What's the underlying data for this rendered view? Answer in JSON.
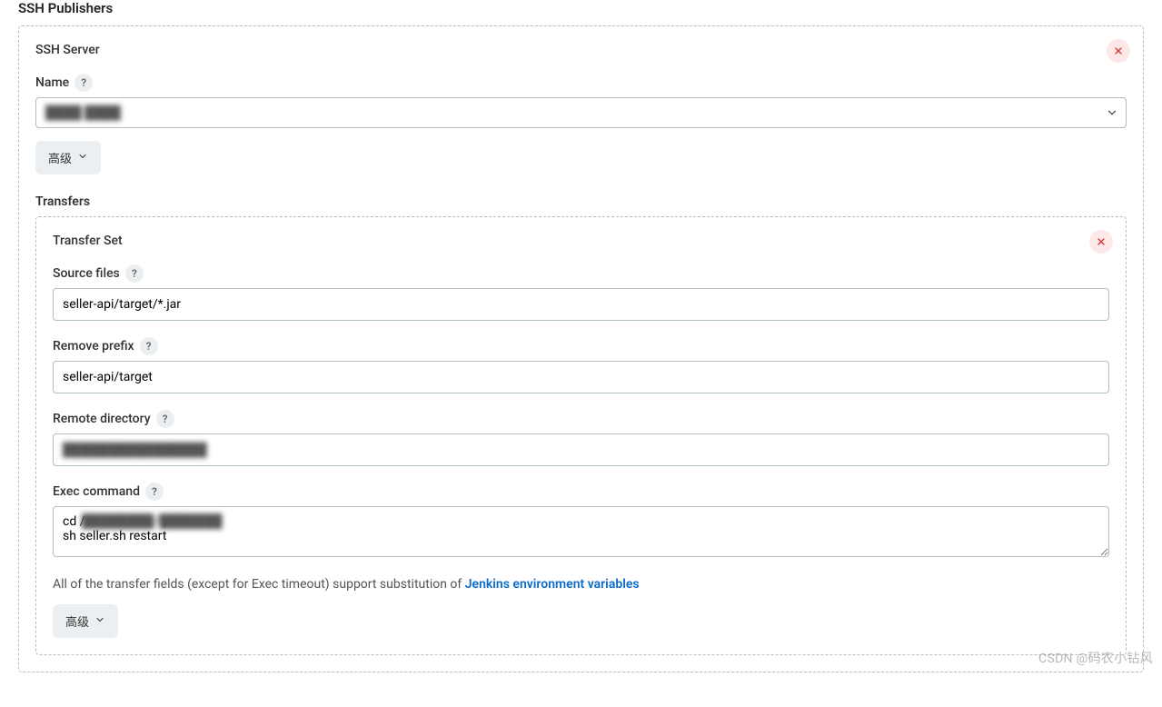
{
  "section": {
    "title": "SSH Publishers"
  },
  "ssh_server": {
    "header": "SSH Server",
    "name_label": "Name",
    "name_value_redacted": "████ ████",
    "advanced_btn": "高级"
  },
  "transfers": {
    "label": "Transfers",
    "transfer_set_header": "Transfer Set",
    "source_files_label": "Source files",
    "source_files_value": "seller-api/target/*.jar",
    "remove_prefix_label": "Remove prefix",
    "remove_prefix_value": "seller-api/target",
    "remote_dir_label": "Remote directory",
    "remote_dir_value_redacted": "████████████████",
    "exec_command_label": "Exec command",
    "exec_command_value": "cd /                         ;\nsh seller.sh restart",
    "exec_blur_part": "████████/███████",
    "info_prefix": "All of the transfer fields (except for Exec timeout) support substitution of ",
    "info_link": "Jenkins environment variables",
    "advanced_btn": "高级"
  },
  "watermark": "CSDN @码农小钻风"
}
